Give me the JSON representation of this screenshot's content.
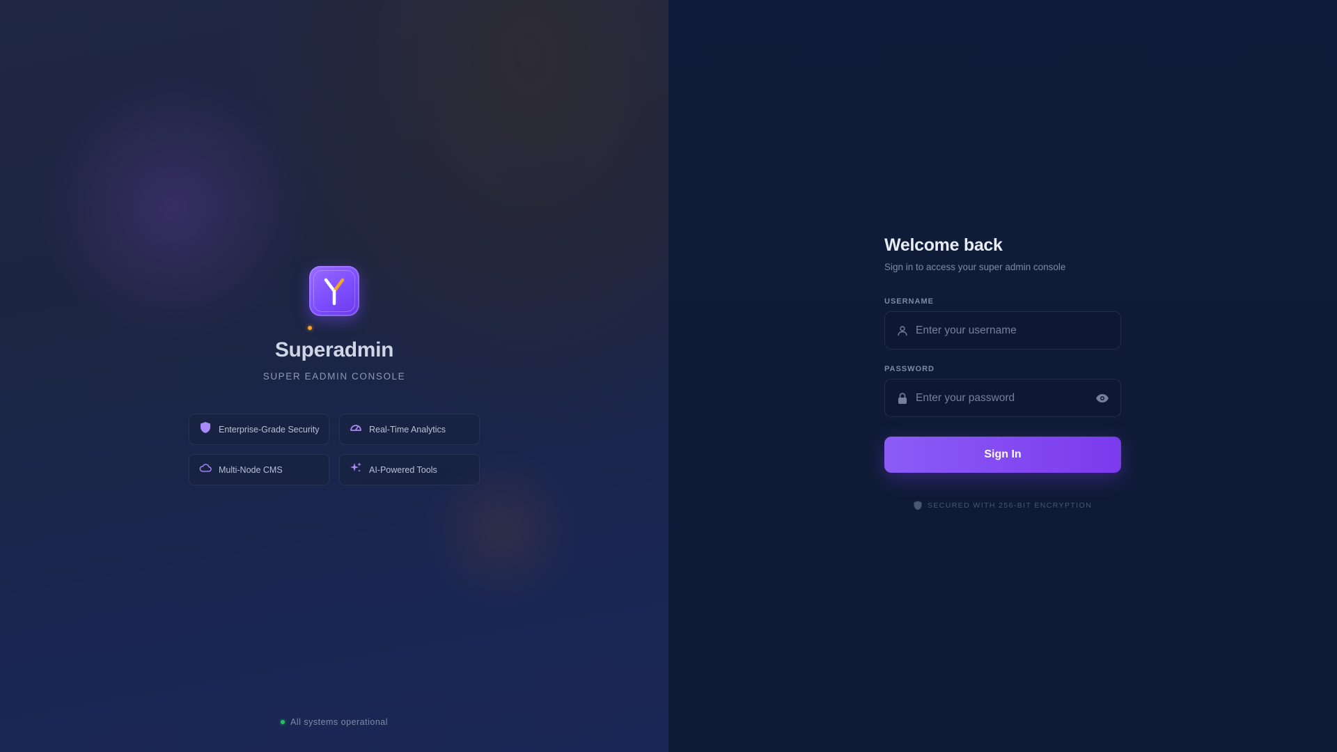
{
  "brand": {
    "title": "Superadmin",
    "subtitle": "SUPER EADMIN CONSOLE",
    "logo_icon": "y-logo-icon",
    "accent_color": "#7c4dff",
    "dot_color": "#f5a524"
  },
  "features": [
    {
      "label": "Enterprise-Grade Security",
      "icon": "shield-icon"
    },
    {
      "label": "Real-Time Analytics",
      "icon": "gauge-icon"
    },
    {
      "label": "Multi-Node CMS",
      "icon": "cloud-icon"
    },
    {
      "label": "AI-Powered Tools",
      "icon": "sparkles-icon"
    }
  ],
  "status": {
    "text": "All systems operational",
    "color": "#22c55e"
  },
  "login": {
    "title": "Welcome back",
    "subtitle": "Sign in to access your super admin console",
    "username": {
      "label": "USERNAME",
      "placeholder": "Enter your username",
      "value": "",
      "icon": "user-icon"
    },
    "password": {
      "label": "PASSWORD",
      "placeholder": "Enter your password",
      "value": "",
      "icon": "lock-icon",
      "toggle_icon": "eye-icon"
    },
    "submit_label": "Sign In",
    "button_color": "#7c3aed",
    "security_note": "SECURED WITH 256-BIT ENCRYPTION",
    "security_icon": "shield-icon"
  }
}
